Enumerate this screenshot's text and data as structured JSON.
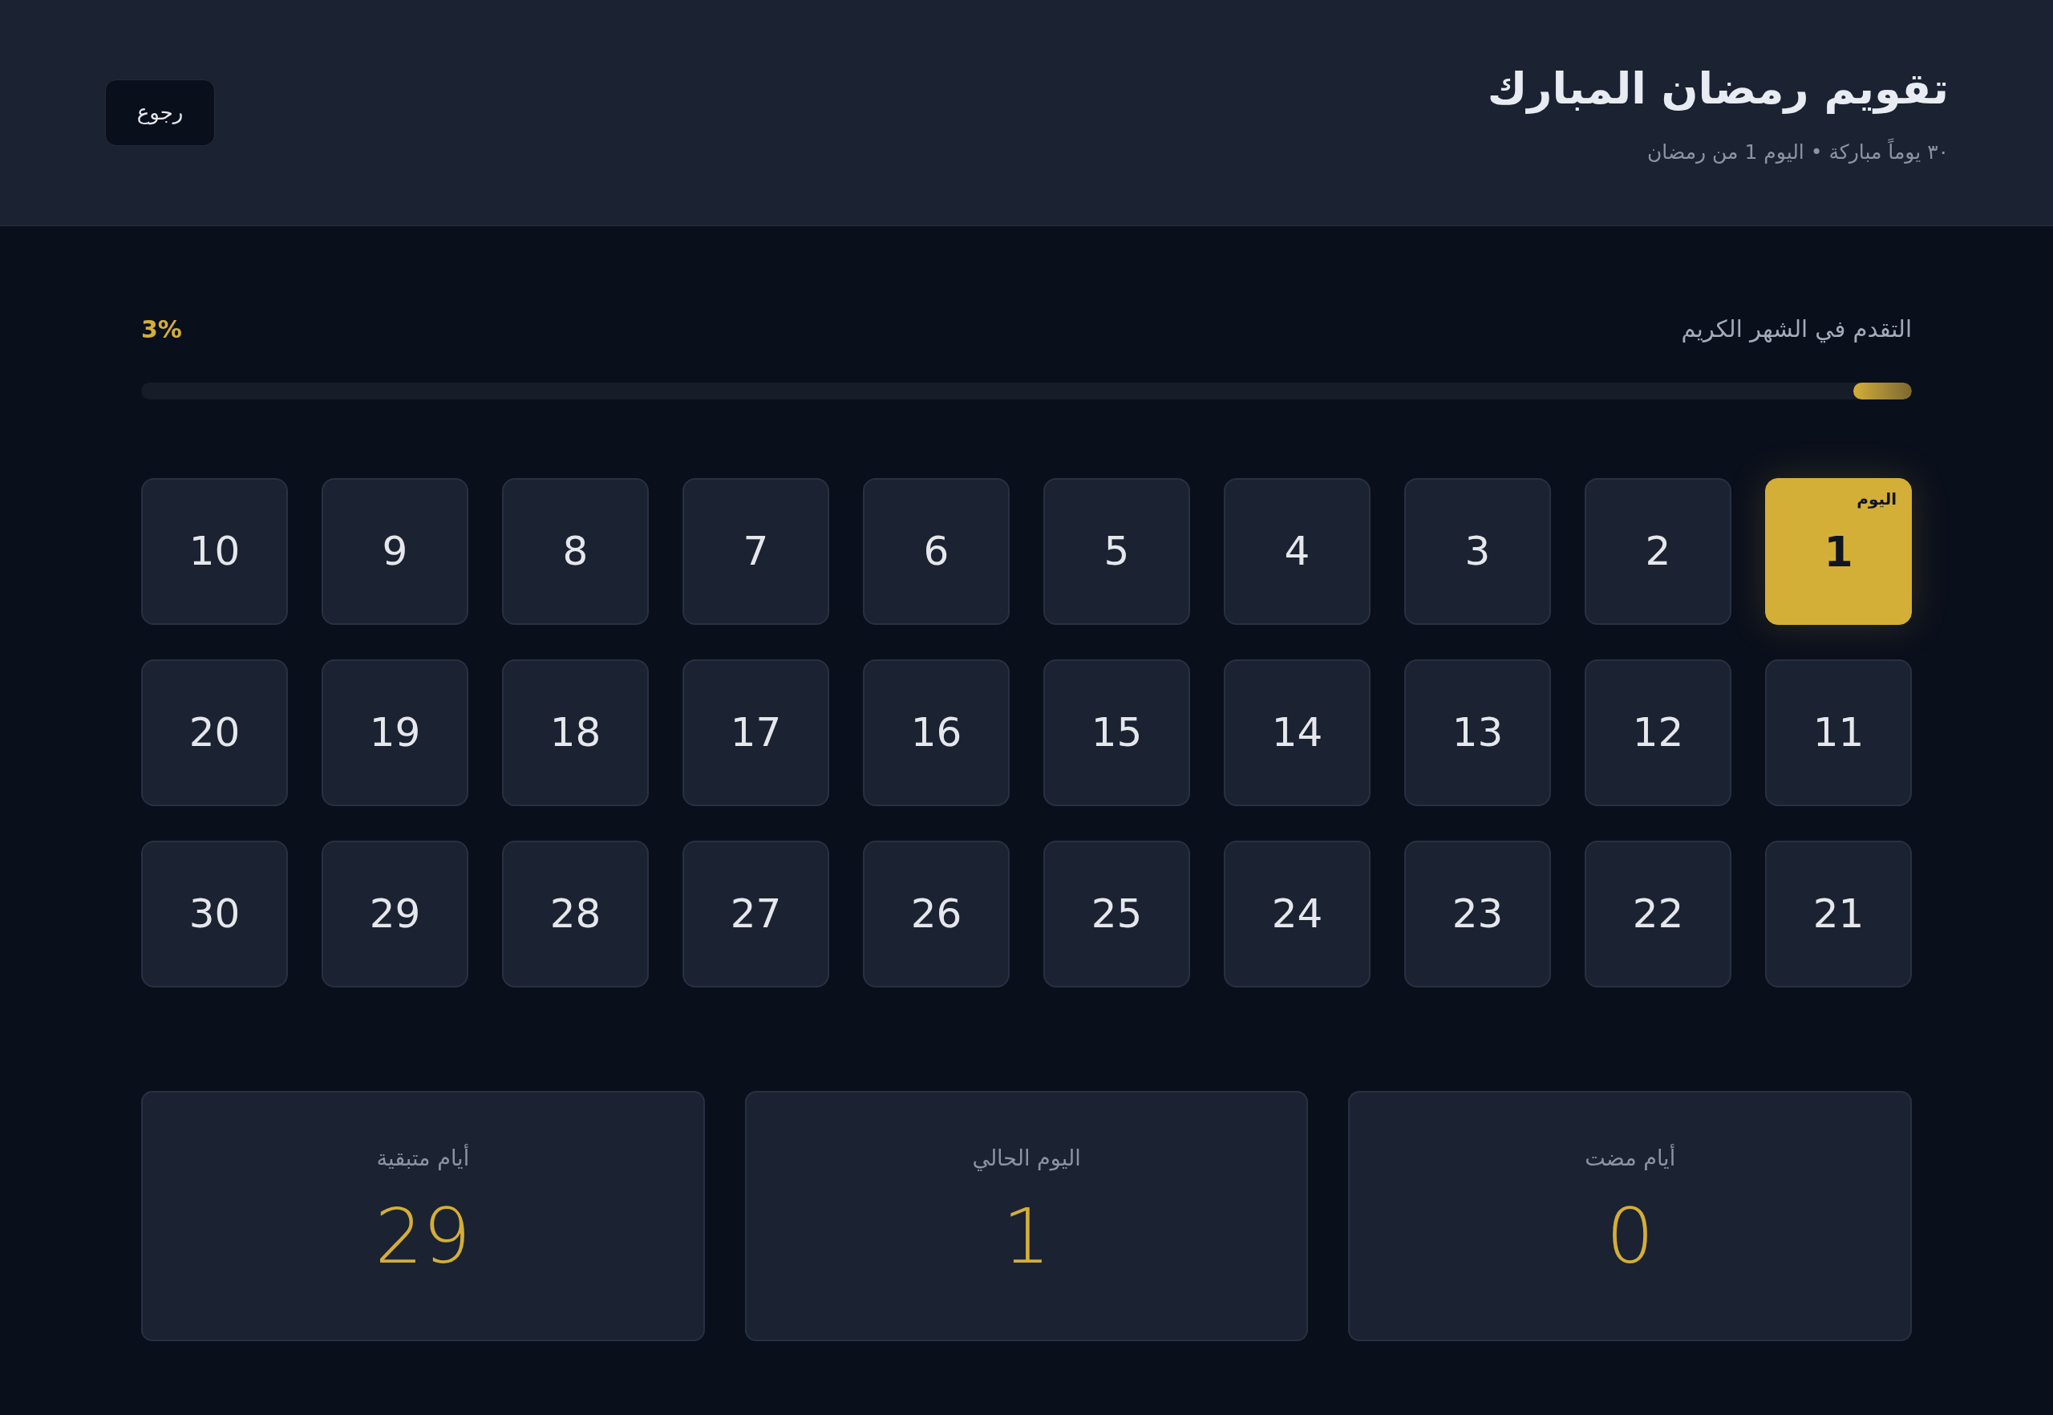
{
  "header": {
    "title": "تقويم رمضان المبارك",
    "subtitle": "٣٠ يوماً مباركة • اليوم 1 من رمضان",
    "back_button": "رجوع"
  },
  "progress": {
    "label": "التقدم في الشهر الكريم",
    "percent": "3%",
    "level": 0.033
  },
  "days": [
    {
      "number": "1",
      "selected": true,
      "badge": "اليوم"
    },
    {
      "number": "2",
      "selected": false
    },
    {
      "number": "3",
      "selected": false
    },
    {
      "number": "4",
      "selected": false
    },
    {
      "number": "5",
      "selected": false
    },
    {
      "number": "6",
      "selected": false
    },
    {
      "number": "7",
      "selected": false
    },
    {
      "number": "8",
      "selected": false
    },
    {
      "number": "9",
      "selected": false
    },
    {
      "number": "10",
      "selected": false
    },
    {
      "number": "11",
      "selected": false
    },
    {
      "number": "12",
      "selected": false
    },
    {
      "number": "13",
      "selected": false
    },
    {
      "number": "14",
      "selected": false
    },
    {
      "number": "15",
      "selected": false
    },
    {
      "number": "16",
      "selected": false
    },
    {
      "number": "17",
      "selected": false
    },
    {
      "number": "18",
      "selected": false
    },
    {
      "number": "19",
      "selected": false
    },
    {
      "number": "20",
      "selected": false
    },
    {
      "number": "21",
      "selected": false
    },
    {
      "number": "22",
      "selected": false
    },
    {
      "number": "23",
      "selected": false
    },
    {
      "number": "24",
      "selected": false
    },
    {
      "number": "25",
      "selected": false
    },
    {
      "number": "26",
      "selected": false
    },
    {
      "number": "27",
      "selected": false
    },
    {
      "number": "28",
      "selected": false
    },
    {
      "number": "29",
      "selected": false
    },
    {
      "number": "30",
      "selected": false
    }
  ],
  "stats": [
    {
      "label": "أيام مضت",
      "value": "0"
    },
    {
      "label": "اليوم الحالي",
      "value": "1"
    },
    {
      "label": "أيام متبقية",
      "value": "29"
    }
  ]
}
